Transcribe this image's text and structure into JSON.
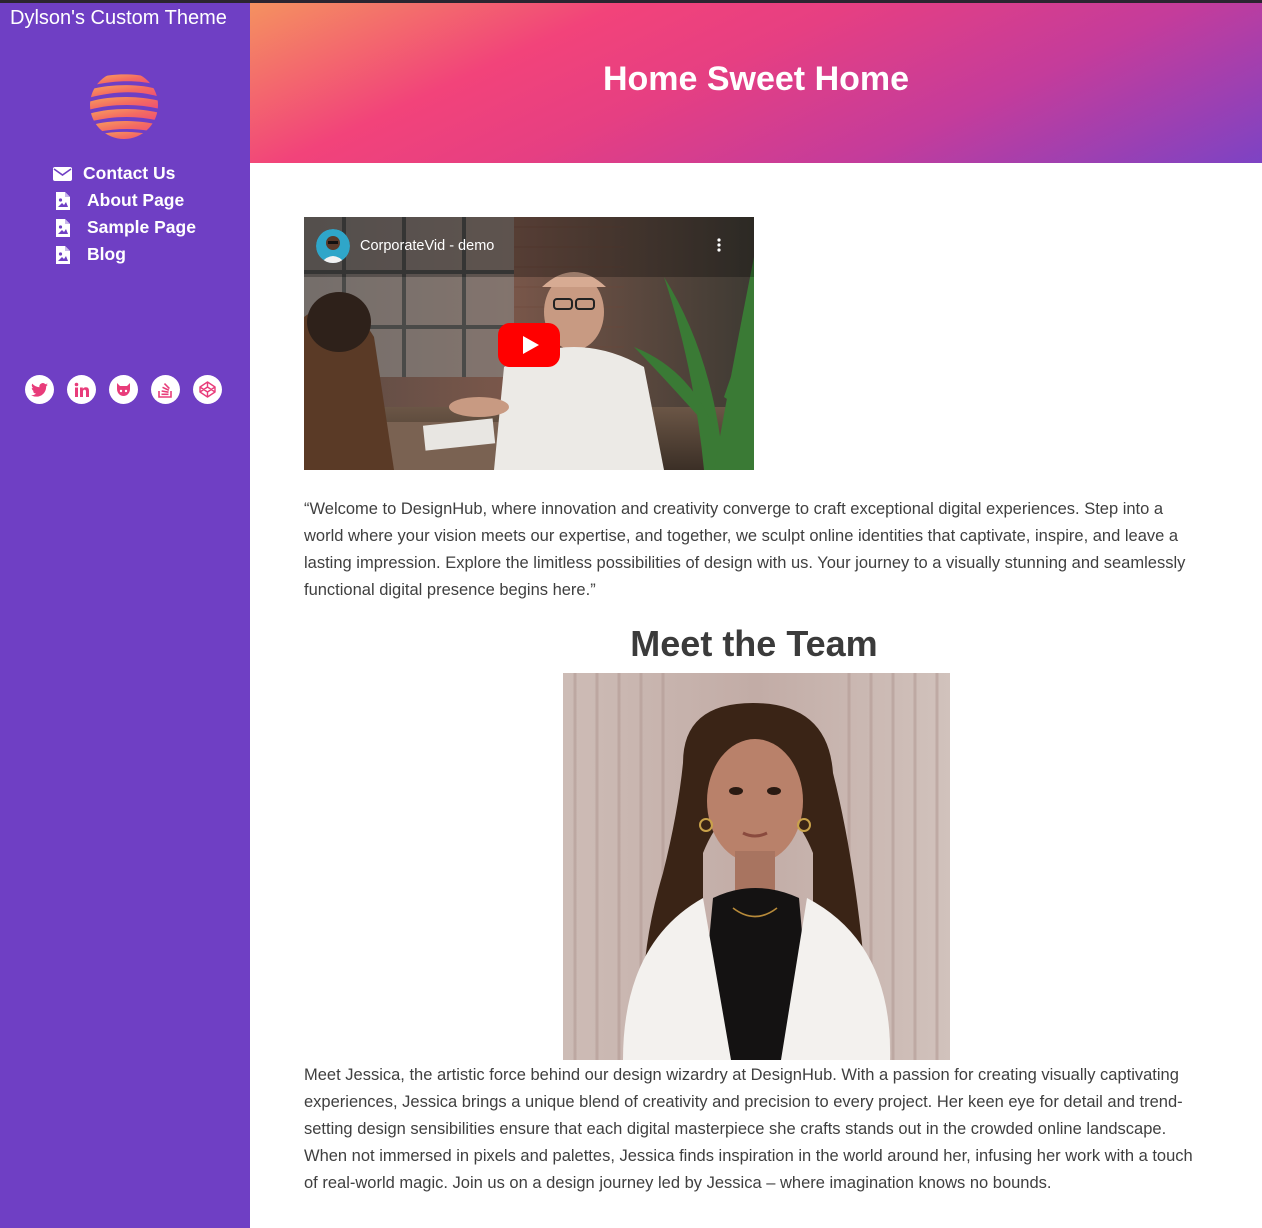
{
  "site": {
    "title": "Dylson's Custom Theme"
  },
  "nav": [
    {
      "label": "Contact Us",
      "icon": "envelope-icon"
    },
    {
      "label": "About Page",
      "icon": "file-image-icon"
    },
    {
      "label": "Sample Page",
      "icon": "file-image-icon"
    },
    {
      "label": "Blog",
      "icon": "file-image-icon"
    }
  ],
  "social": [
    "twitter-icon",
    "linkedin-icon",
    "github-icon",
    "stackoverflow-icon",
    "codepen-icon"
  ],
  "header": {
    "title": "Home Sweet Home"
  },
  "video": {
    "title": "CorporateVid - demo"
  },
  "intro": "“Welcome to DesignHub, where innovation and creativity converge to craft exceptional digital experiences. Step into a world where your vision meets our expertise, and together, we sculpt online identities that captivate, inspire, and leave a lasting impression. Explore the limitless possibilities of design with us. Your journey to a visually stunning and seamlessly functional digital presence begins here.”",
  "team": {
    "heading": "Meet the Team",
    "bio": "Meet Jessica, the artistic force behind our design wizardry at DesignHub. With a passion for creating visually captivating experiences, Jessica brings a unique blend of creativity and precision to every project. Her keen eye for detail and trend-setting design sensibilities ensure that each digital masterpiece she crafts stands out in the crowded online landscape. When not immersed in pixels and palettes, Jessica finds inspiration in the world around her, infusing her work with a touch of real-world magic. Join us on a design journey led by Jessica – where imagination knows no bounds."
  },
  "colors": {
    "sidebar": "#6f3fc4",
    "accent": "#f2437a",
    "play": "#ff0000"
  }
}
